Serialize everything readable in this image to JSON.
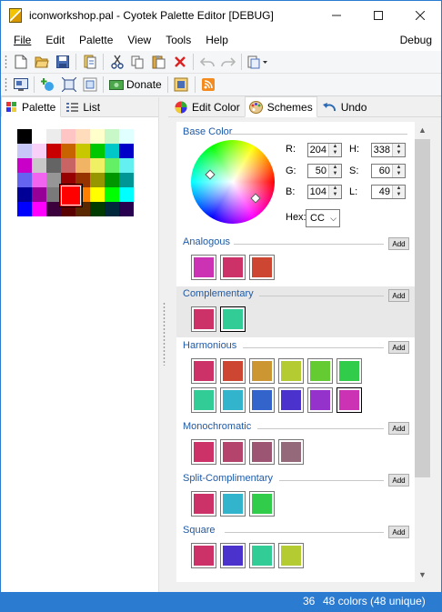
{
  "window": {
    "title": "iconworkshop.pal - Cyotek Palette Editor [DEBUG]",
    "controls": [
      "minimize-icon",
      "maximize-icon",
      "close-icon"
    ]
  },
  "menu": {
    "items": [
      "File",
      "Edit",
      "Palette",
      "View",
      "Tools",
      "Help"
    ],
    "debug": "Debug"
  },
  "toolbar1": [
    "new-icon",
    "open-icon",
    "save-icon",
    "properties-icon",
    "cut-icon",
    "copy-icon",
    "paste-icon",
    "delete-icon",
    "undo-icon",
    "redo-icon",
    "paste-special-icon"
  ],
  "toolbar2": {
    "icons": [
      "screen-icon",
      "add-color-icon",
      "fit-icon",
      "zoom-icon",
      "donate-icon",
      "extra-icon",
      "rss-icon"
    ],
    "donate_label": "Donate"
  },
  "left_tabs": [
    {
      "label": "Palette",
      "icon": "palette-grid-icon",
      "active": true
    },
    {
      "label": "List",
      "icon": "list-icon",
      "active": false
    }
  ],
  "palette": {
    "selected_index": 34,
    "colors": [
      "#000000",
      "#ffffff",
      "#ececec",
      "#ffc4c4",
      "#ffdcbc",
      "#ffffcc",
      "#c8f8c8",
      "#e0ffff",
      "#c8c8f8",
      "#f8d0f8",
      "#c80000",
      "#c86400",
      "#c8c800",
      "#00c800",
      "#00c8c8",
      "#0000c8",
      "#c800c8",
      "#c8c8c8",
      "#646464",
      "#c86464",
      "#f0b464",
      "#f0f064",
      "#64f064",
      "#64f0f0",
      "#6464f0",
      "#f064f0",
      "#969696",
      "#960000",
      "#963200",
      "#969600",
      "#009600",
      "#009696",
      "#000096",
      "#960096",
      "#7a7a7a",
      "#ff0000",
      "#ff8000",
      "#ffff00",
      "#00ff00",
      "#00ffff",
      "#0000ff",
      "#ff00ff",
      "#3c003c",
      "#5a0000",
      "#5a2800",
      "#003c00",
      "#00283c",
      "#280050"
    ]
  },
  "right_tabs": [
    {
      "label": "Edit Color",
      "icon": "color-wheel-icon",
      "active": false
    },
    {
      "label": "Schemes",
      "icon": "palette-icon",
      "active": true
    },
    {
      "label": "Undo",
      "icon": "undo-arrow-icon",
      "active": false
    }
  ],
  "base_color": {
    "title": "Base Color",
    "r_label": "R:",
    "r": "204",
    "g_label": "G:",
    "g": "50",
    "b_label": "B:",
    "b": "104",
    "h_label": "H:",
    "h": "338",
    "s_label": "S:",
    "s": "60",
    "l_label": "L:",
    "l": "49",
    "hex_label": "Hex:",
    "hex": "CC"
  },
  "add_label": "Add",
  "groups": [
    {
      "title": "Analogous",
      "colors": [
        "#cc32b4",
        "#cc3268",
        "#cc4632"
      ]
    },
    {
      "title": "Complementary",
      "colors": [
        "#cc3268",
        "#32cc96"
      ],
      "selected": 1,
      "highlight": true
    },
    {
      "title": "Harmonious",
      "colors": [
        "#cc3268",
        "#cc4632",
        "#cc9632",
        "#b4cc32",
        "#64cc32",
        "#32cc4b",
        "#32cc96",
        "#32b4cc",
        "#3264cc",
        "#4b32cc",
        "#9632cc",
        "#cc32b4"
      ],
      "selected": 11
    },
    {
      "title": "Monochromatic",
      "colors": [
        "#cc3268",
        "#b4446c",
        "#9c5674",
        "#946a7a"
      ]
    },
    {
      "title": "Split-Complimentary",
      "colors": [
        "#cc3268",
        "#32b4cc",
        "#32cc4b"
      ]
    },
    {
      "title": "Square",
      "colors": [
        "#cc3268",
        "#4b32cc",
        "#32cc96",
        "#b4cc32"
      ]
    }
  ],
  "status": {
    "index": "36",
    "summary": "48 colors (48 unique)"
  }
}
